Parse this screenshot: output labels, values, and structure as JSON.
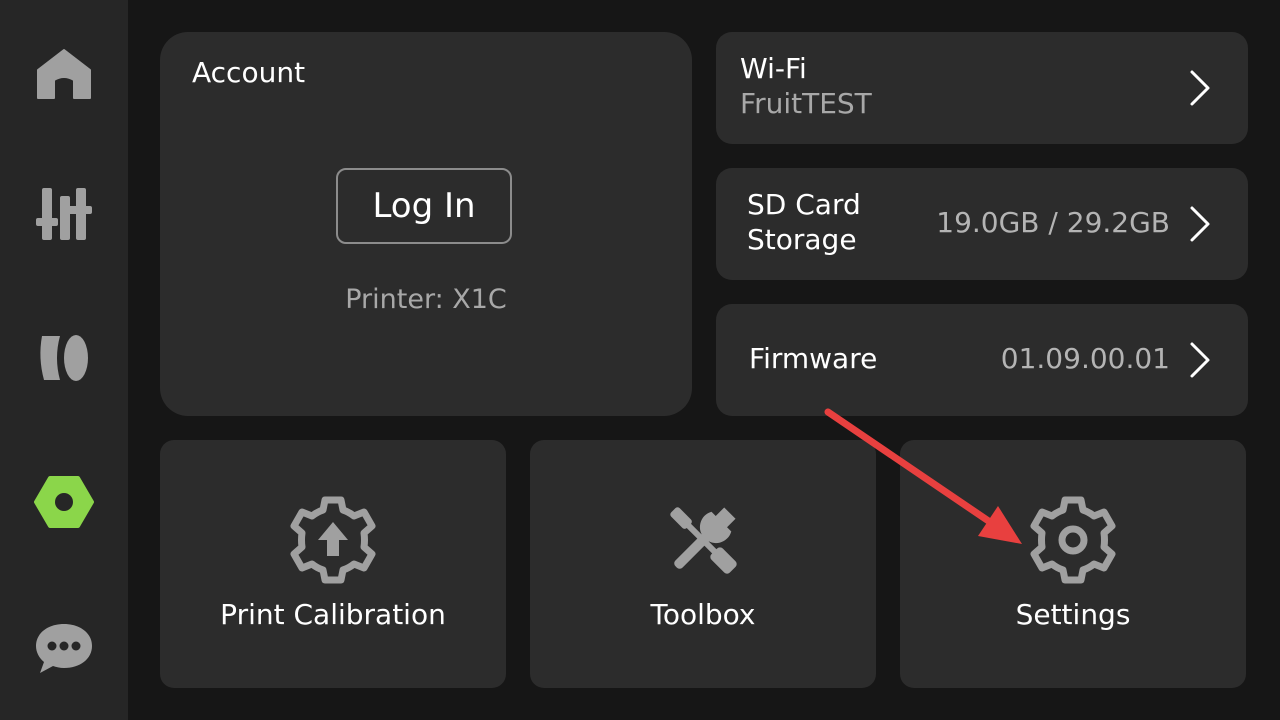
{
  "sidebar": {
    "items": [
      {
        "icon": "home-icon"
      },
      {
        "icon": "controls-icon"
      },
      {
        "icon": "filament-icon"
      },
      {
        "icon": "settings-hex-icon",
        "active": true,
        "color": "#8bd64a"
      },
      {
        "icon": "chat-icon"
      }
    ]
  },
  "account": {
    "title": "Account",
    "login_label": "Log In",
    "printer_line": "Printer: X1C"
  },
  "wifi": {
    "title": "Wi-Fi",
    "network": "FruitTEST"
  },
  "sd_card": {
    "title_line1": "SD Card",
    "title_line2": "Storage",
    "value": "19.0GB / 29.2GB"
  },
  "firmware": {
    "title": "Firmware",
    "value": "01.09.00.01"
  },
  "tiles": {
    "calibration": {
      "label": "Print Calibration",
      "icon": "calibration-gear-icon"
    },
    "toolbox": {
      "label": "Toolbox",
      "icon": "tools-icon"
    },
    "settings": {
      "label": "Settings",
      "icon": "gear-icon"
    }
  },
  "colors": {
    "background": "#161616",
    "sidebar": "#262626",
    "card": "#2c2c2c",
    "accent": "#8bd64a",
    "annotation_arrow": "#e8403f"
  }
}
